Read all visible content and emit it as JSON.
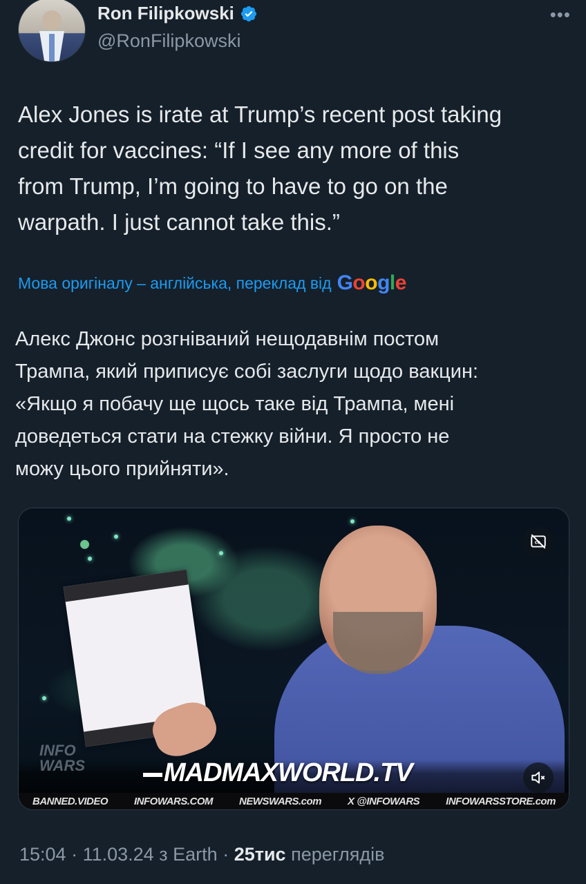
{
  "author": {
    "name": "Ron Filipkowski",
    "handle": "@RonFilipkowski",
    "verified": true
  },
  "menu": {
    "more_label": "•••"
  },
  "tweet": {
    "text": "Alex Jones is irate at Trump’s recent post taking\ncredit for vaccines: “If I see any more of this\nfrom Trump, I’m going to have to go on the\nwarpath. I just cannot take this.”"
  },
  "translation": {
    "notice": "Мова оригіналу – англійська, переклад від",
    "provider": "Google",
    "text": "Алекс Джонс розгніваний нещодавнім постом\nТрампа, який приписує собі заслуги щодо вакцин:\n«Якщо я побачу ще щось таке від Трампа, мені\nдоведеться стати на стежку війни. Я просто не\nможу цього прийняти»."
  },
  "media": {
    "overlay_logo": "INFO WARS",
    "title_overlay": "MADMAXWORLD.TV",
    "ticker": [
      "BANNED.VIDEO",
      "INFOWARS.COM",
      "NEWSWARS.com",
      "X @INFOWARS",
      "INFOWARSSTORE.com"
    ]
  },
  "meta": {
    "time": "15:04",
    "date": "11.03.24",
    "source_prefix": "з",
    "source": "Earth",
    "views_count": "25тис",
    "views_label": "переглядів"
  },
  "colors": {
    "background": "#15202b",
    "text_primary": "#e7e9ea",
    "text_secondary": "#8b98a5",
    "accent_blue": "#1d9bf0"
  }
}
